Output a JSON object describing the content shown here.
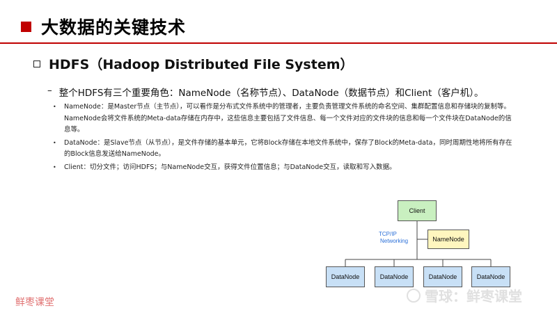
{
  "title": "大数据的关键技术",
  "heading": "HDFS（Hadoop Distributed File System）",
  "subheading": {
    "dash": "–",
    "text": "整个HDFS有三个重要角色：NameNode（名称节点）、DataNode（数据节点）和Client（客户机）。"
  },
  "bullets": [
    {
      "marker": "•",
      "text": "NameNode：是Master节点（主节点），可以看作是分布式文件系统中的管理者，主要负责管理文件系统的命名空间、集群配置信息和存储块的复制等。NameNode会将文件系统的Meta-data存储在内存中，这些信息主要包括了文件信息、每一个文件对应的文件块的信息和每一个文件块在DataNode的信息等。"
    },
    {
      "marker": "•",
      "text": "DataNode：是Slave节点（从节点），是文件存储的基本单元，它将Block存储在本地文件系统中，保存了Block的Meta-data，同时周期性地将所有存在的Block信息发送给NameNode。"
    },
    {
      "marker": "•",
      "text": "Client：切分文件；访问HDFS；与NameNode交互，获得文件位置信息；与DataNode交互，读取和写入数据。"
    }
  ],
  "diagram": {
    "client": "Client",
    "namenode": "NameNode",
    "tcp_line1": "TCP/IP",
    "tcp_line2": "Networking",
    "datanodes": [
      "DataNode",
      "DataNode",
      "DataNode",
      "DataNode"
    ]
  },
  "watermark_left": "鲜枣课堂",
  "watermark_right": "雪球：鲜枣课堂",
  "colors": {
    "accent": "#c00000",
    "client": "#c9f0c0",
    "namenode": "#fff6bf",
    "datanode": "#c8e0f6"
  }
}
